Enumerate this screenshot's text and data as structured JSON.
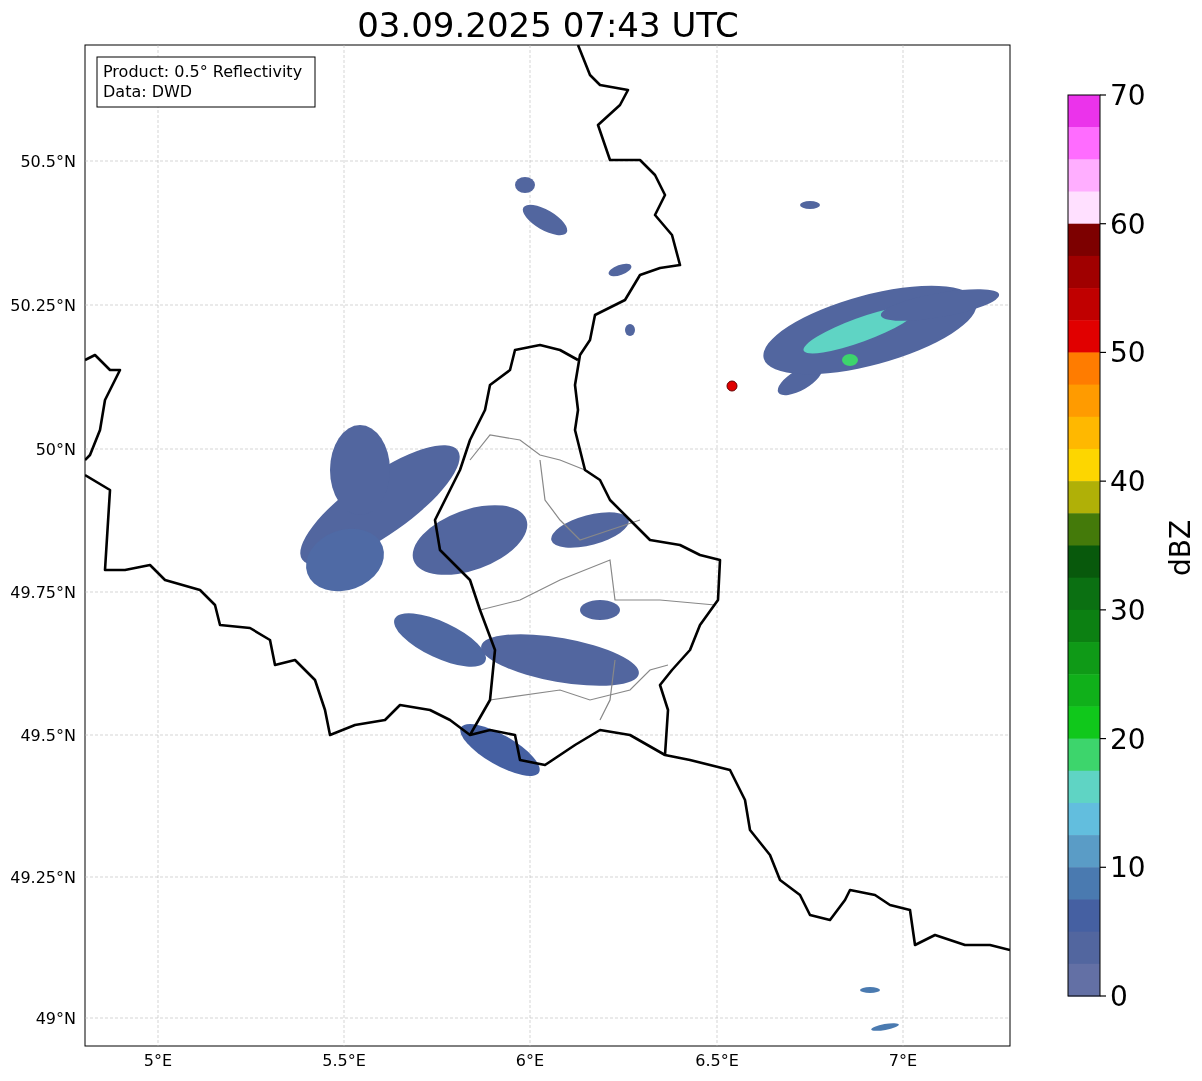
{
  "title": "03.09.2025 07:43 UTC",
  "map": {
    "info_box": [
      "Product: 0.5° Reflectivity",
      "Data: DWD"
    ],
    "yticks": [
      "50.5°N",
      "50.25°N",
      "50°N",
      "49.75°N",
      "49.5°N",
      "49.25°N",
      "49°N"
    ],
    "xticks": [
      "5°E",
      "5.5°E",
      "6°E",
      "6.5°E",
      "7°E"
    ]
  },
  "colorbar": {
    "label": "dBZ",
    "ticks": [
      "70",
      "60",
      "50",
      "40",
      "30",
      "20",
      "10",
      "0"
    ],
    "segments": [
      {
        "color": "#eb33eb"
      },
      {
        "color": "#ff6cff"
      },
      {
        "color": "#ffaeff"
      },
      {
        "color": "#ffe0ff"
      },
      {
        "color": "#7d0000"
      },
      {
        "color": "#a00000"
      },
      {
        "color": "#c00000"
      },
      {
        "color": "#e10000"
      },
      {
        "color": "#ff7c00"
      },
      {
        "color": "#ff9b00"
      },
      {
        "color": "#ffb800"
      },
      {
        "color": "#fdd600"
      },
      {
        "color": "#b0b007"
      },
      {
        "color": "#447a0a"
      },
      {
        "color": "#08590c"
      },
      {
        "color": "#0b7012"
      },
      {
        "color": "#0c8012"
      },
      {
        "color": "#0f9a17"
      },
      {
        "color": "#10b01a"
      },
      {
        "color": "#10c81b"
      },
      {
        "color": "#3dd56c"
      },
      {
        "color": "#5fd4c4"
      },
      {
        "color": "#62bede"
      },
      {
        "color": "#5a9cc6"
      },
      {
        "color": "#4a7ab0"
      },
      {
        "color": "#4560a2"
      },
      {
        "color": "#52669f"
      },
      {
        "color": "#6370a5"
      }
    ]
  }
}
